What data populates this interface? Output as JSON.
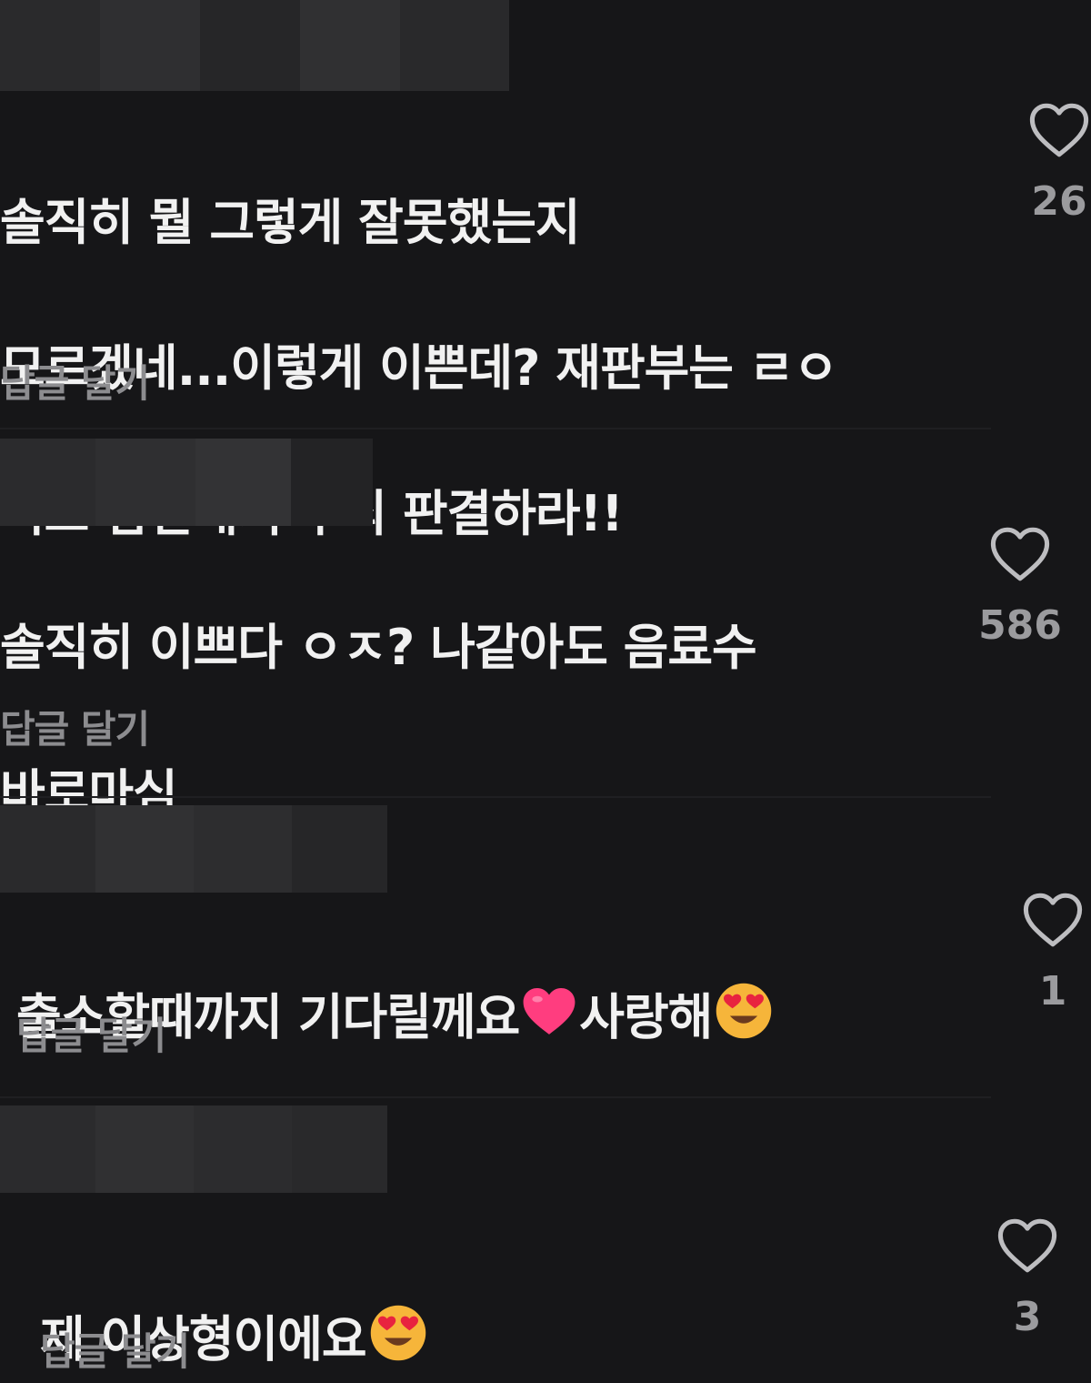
{
  "reply_label": "답글 달기",
  "colors": {
    "background": "#161618",
    "text": "#f1f1f1",
    "muted": "#8c8c8f",
    "heart_emoji": "#ff3d7f",
    "smiley_emoji": "#f6b53a"
  },
  "comments": [
    {
      "lines": [
        "솔직히 뭘 그렇게 잘못했는지",
        "모르겠네...이렇게 이쁜데? 재판부는 ㄹㅇ",
        "외모 감안해서 무죄 판결하라!!"
      ],
      "likes": "26",
      "like_icon": "heart-outline-icon"
    },
    {
      "lines": [
        "솔직히 이쁘다 ㅇㅈ? 나같아도 음료수",
        "바로마심"
      ],
      "likes": "586",
      "like_icon": "heart-outline-icon"
    },
    {
      "segments": [
        "출소할때까지 기다릴께요",
        "사랑해"
      ],
      "emojis": [
        "red-heart-emoji",
        "heart-eyes-emoji"
      ],
      "likes": "1",
      "like_icon": "heart-outline-icon"
    },
    {
      "segments": [
        "제 이상형이에요"
      ],
      "emojis": [
        "heart-eyes-emoji"
      ],
      "likes": "3",
      "like_icon": "heart-outline-icon"
    }
  ]
}
